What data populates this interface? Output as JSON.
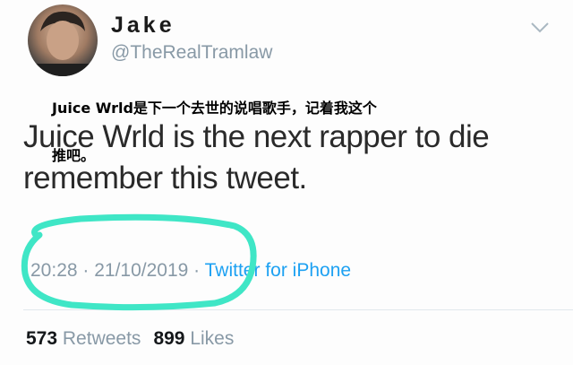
{
  "user": {
    "name": "Jake",
    "handle": "@TheRealTramlaw"
  },
  "overlay": {
    "line1": "Juice Wrld是下一个去世的说唱歌手，记着我这个",
    "line2": "推吧。"
  },
  "tweet": {
    "text_line1": "Juice Wrld is the next rapper to die",
    "text_line2": "remember this tweet."
  },
  "meta": {
    "time": "20:28",
    "separator": " · ",
    "date": "21/10/2019",
    "source": "Twitter for iPhone"
  },
  "stats": {
    "retweets_count": "573",
    "retweets_label": "Retweets",
    "likes_count": "899",
    "likes_label": "Likes"
  },
  "colors": {
    "circle": "#3fe6c6",
    "link": "#1da1f2",
    "muted": "#8899a6"
  },
  "icons": {
    "menu": "chevron-down-icon"
  }
}
